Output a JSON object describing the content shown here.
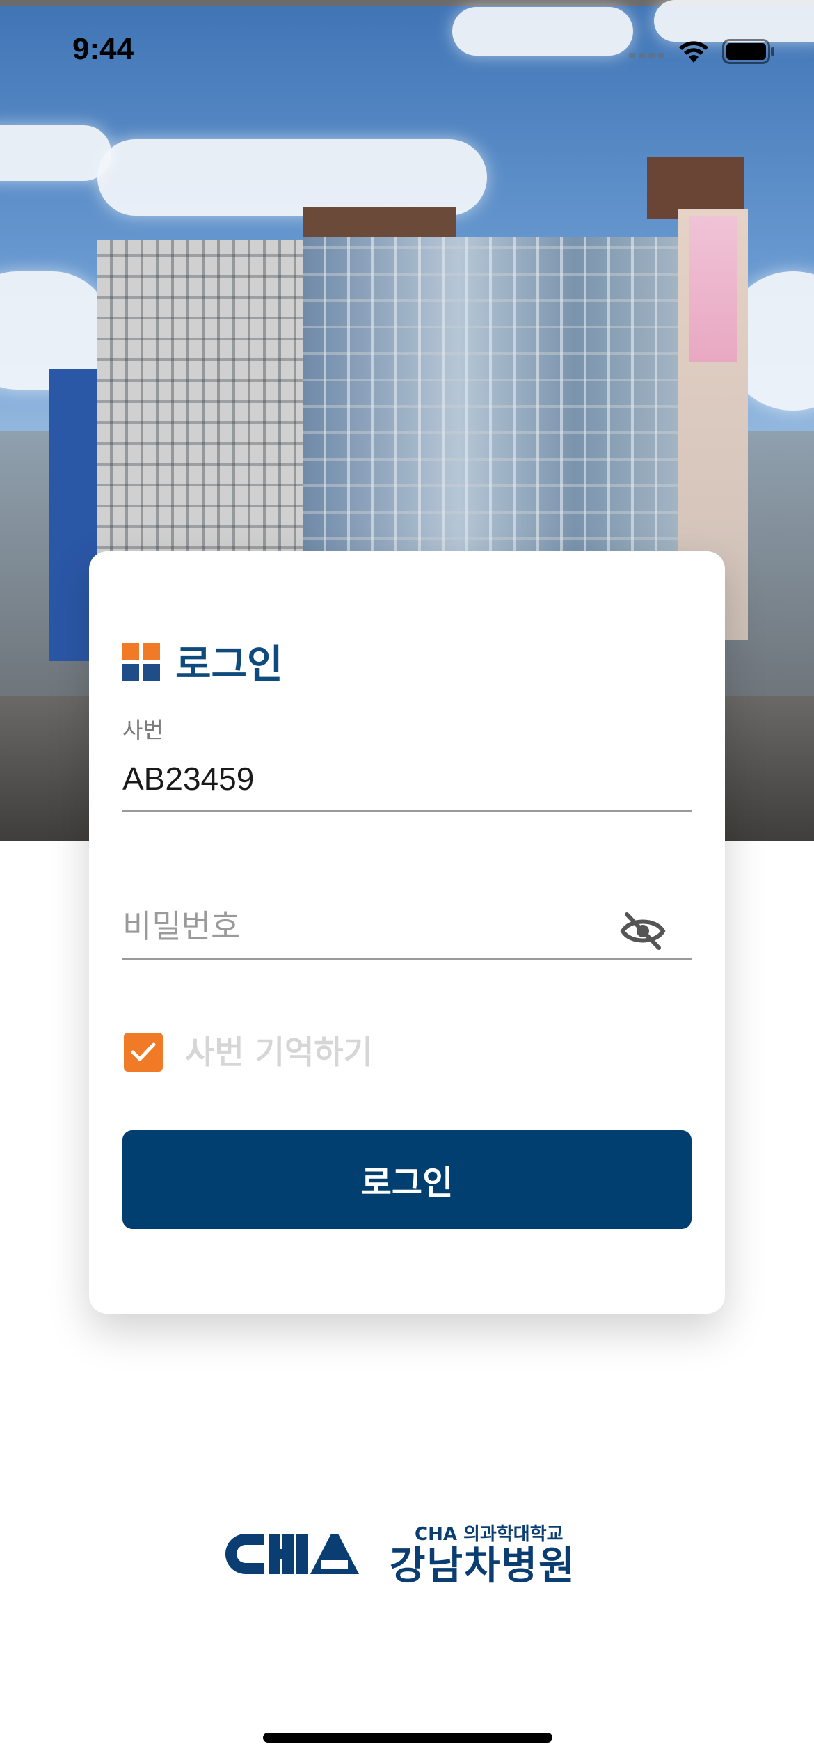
{
  "status_bar": {
    "time": "9:44"
  },
  "hero": {
    "image_icon": "hospital-building-photo"
  },
  "login": {
    "title": "로그인",
    "title_icon": "four-squares-icon",
    "employee_id": {
      "label": "사번",
      "value": "AB23459"
    },
    "password": {
      "placeholder": "비밀번호",
      "toggle_icon": "eye-slash-icon"
    },
    "remember": {
      "checked": true,
      "label": "사번 기억하기"
    },
    "submit_label": "로그인"
  },
  "footer": {
    "logo_mark": "CHA",
    "school": "CHA 의과학대학교",
    "hospital": "강남차병원"
  },
  "colors": {
    "primary": "#003f6f",
    "accent": "#f07a25",
    "title": "#0f4a7d"
  }
}
